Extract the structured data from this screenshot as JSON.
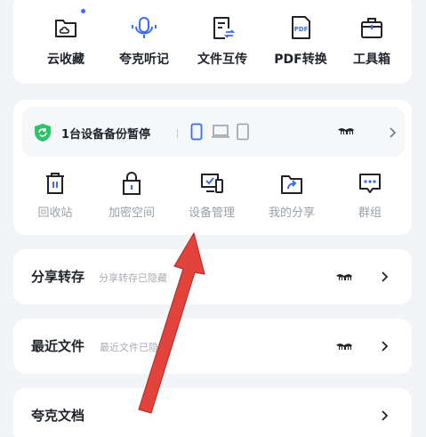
{
  "colors": {
    "background": "#f3f4f7",
    "card": "#ffffff",
    "icon_stroke": "#1f2329",
    "accent_blue": "#3a6cf3",
    "shield_green": "#2ec26a",
    "muted_text": "#9aa0a8",
    "annotation_arrow": "#e2433b"
  },
  "top_tools": [
    {
      "label": "云收藏",
      "icon": "cloud-folder-icon"
    },
    {
      "label": "夸克听记",
      "icon": "microphone-icon"
    },
    {
      "label": "文件互传",
      "icon": "file-transfer-icon"
    },
    {
      "label": "PDF转换",
      "icon": "pdf-icon"
    },
    {
      "label": "工具箱",
      "icon": "toolbox-icon"
    }
  ],
  "backup": {
    "status_text": "1台设备备份暂停",
    "devices": [
      "phone-icon",
      "laptop-icon",
      "tablet-icon"
    ],
    "icons": [
      "shield-sync-icon",
      "mustache-icon",
      "chevron-right-icon"
    ]
  },
  "sub_tools": [
    {
      "label": "回收站",
      "icon": "trash-icon"
    },
    {
      "label": "加密空间",
      "icon": "lock-box-icon"
    },
    {
      "label": "设备管理",
      "icon": "device-manage-icon"
    },
    {
      "label": "我的分享",
      "icon": "share-icon"
    },
    {
      "label": "群组",
      "icon": "group-chat-icon"
    }
  ],
  "rows": [
    {
      "title": "分享转存",
      "hint": "分享转存已隐藏"
    },
    {
      "title": "最近文件",
      "hint": "最近文件已隐藏"
    },
    {
      "title": "夸克文档",
      "hint": ""
    }
  ]
}
